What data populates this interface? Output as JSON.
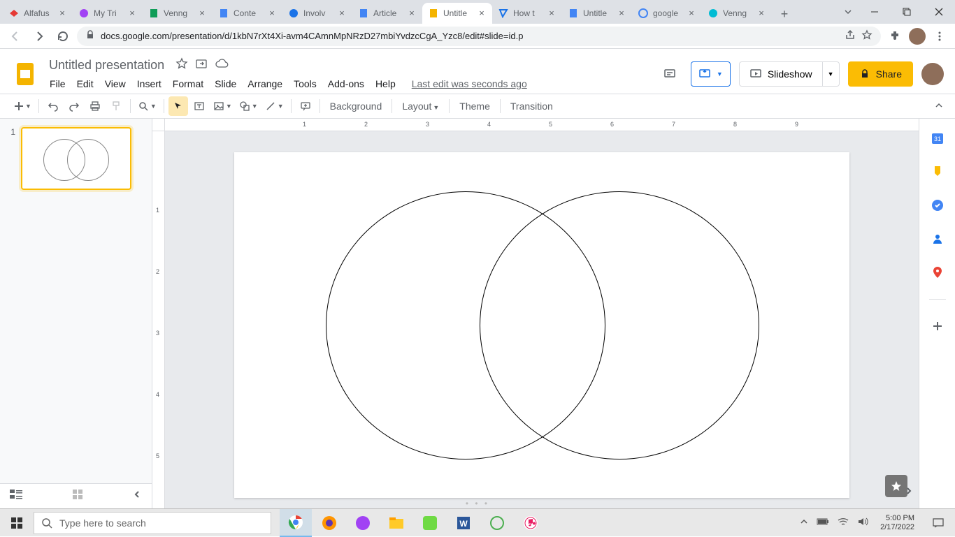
{
  "browser": {
    "tabs": [
      {
        "title": "Alfafus"
      },
      {
        "title": "My Tri"
      },
      {
        "title": "Venng"
      },
      {
        "title": "Conte"
      },
      {
        "title": "Involv"
      },
      {
        "title": "Article"
      },
      {
        "title": "Untitle"
      },
      {
        "title": "How t"
      },
      {
        "title": "Untitle"
      },
      {
        "title": "google"
      },
      {
        "title": "Venng"
      }
    ],
    "active_tab_index": 6,
    "url": "docs.google.com/presentation/d/1kbN7rXt4Xi-avm4CAmnMpNRzD27mbiYvdzcCgA_Yzc8/edit#slide=id.p"
  },
  "doc": {
    "title": "Untitled presentation",
    "menus": [
      "File",
      "Edit",
      "View",
      "Insert",
      "Format",
      "Slide",
      "Arrange",
      "Tools",
      "Add-ons",
      "Help"
    ],
    "last_edit": "Last edit was seconds ago",
    "slideshow_label": "Slideshow",
    "share_label": "Share"
  },
  "toolbar": {
    "background": "Background",
    "layout": "Layout",
    "theme": "Theme",
    "transition": "Transition"
  },
  "filmstrip": {
    "slide_number": "1"
  },
  "ruler_h": [
    "1",
    "2",
    "3",
    "4",
    "5",
    "6",
    "7",
    "8",
    "9"
  ],
  "ruler_v": [
    "1",
    "2",
    "3",
    "4",
    "5"
  ],
  "taskbar": {
    "search_placeholder": "Type here to search",
    "time": "5:00 PM",
    "date": "2/17/2022"
  }
}
